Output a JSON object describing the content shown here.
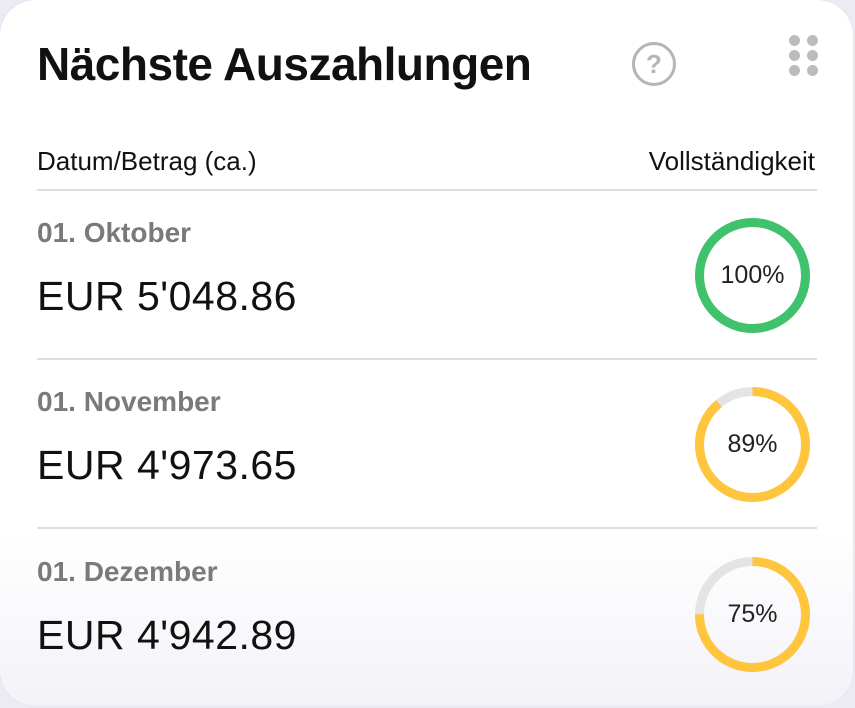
{
  "widget": {
    "title": "Nächste Auszahlungen",
    "help_icon_glyph": "?",
    "help_icon": "question-circle-icon",
    "drag_icon": "drag-handle-icon"
  },
  "table": {
    "headers": {
      "date_amount": "Datum/Betrag (ca.)",
      "completeness": "Vollständigkeit"
    },
    "rows": [
      {
        "date": "01. Oktober",
        "amount": "EUR 5'048.86",
        "completeness_label": "100%",
        "completeness": 1.0,
        "color": "#3fc26b"
      },
      {
        "date": "01. November",
        "amount": "EUR 4'973.65",
        "completeness_label": "89%",
        "completeness": 0.89,
        "color": "#ffc53d"
      },
      {
        "date": "01. Dezember",
        "amount": "EUR 4'942.89",
        "completeness_label": "75%",
        "completeness": 0.75,
        "color": "#ffc53d"
      }
    ]
  },
  "colors": {
    "ring_track": "#e4e4e4",
    "complete": "#3fc26b",
    "partial": "#ffc53d"
  }
}
